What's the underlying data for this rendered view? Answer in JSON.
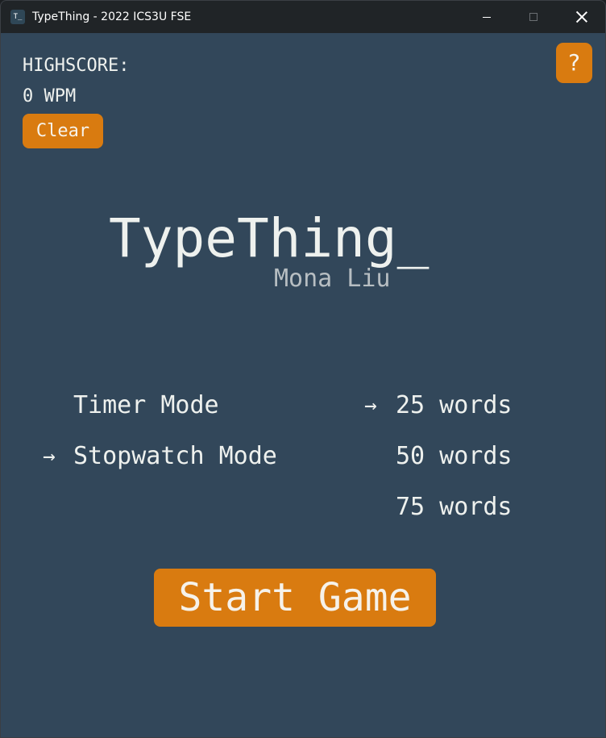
{
  "window": {
    "title": "TypeThing - 2022 ICS3U FSE",
    "icon_text": "T_"
  },
  "highscore": {
    "label": "HIGHSCORE:",
    "value": "0 WPM",
    "clear_label": "Clear"
  },
  "help": {
    "label": "?"
  },
  "title": {
    "name": "TypeThing_",
    "author": "Mona Liu"
  },
  "modes": {
    "selected": "Stopwatch Mode",
    "items": [
      {
        "label": "Timer Mode",
        "selected": false
      },
      {
        "label": "Stopwatch Mode",
        "selected": true
      }
    ]
  },
  "word_counts": {
    "selected": "25 words",
    "items": [
      {
        "label": "25 words",
        "selected": true
      },
      {
        "label": "50 words",
        "selected": false
      },
      {
        "label": "75 words",
        "selected": false
      }
    ]
  },
  "selection_arrow": "→",
  "start": {
    "label": "Start Game"
  },
  "colors": {
    "background": "#32475a",
    "accent": "#d97b10",
    "text": "#eef1ee",
    "subtitle": "#b7bec2",
    "titlebar": "#202427"
  }
}
